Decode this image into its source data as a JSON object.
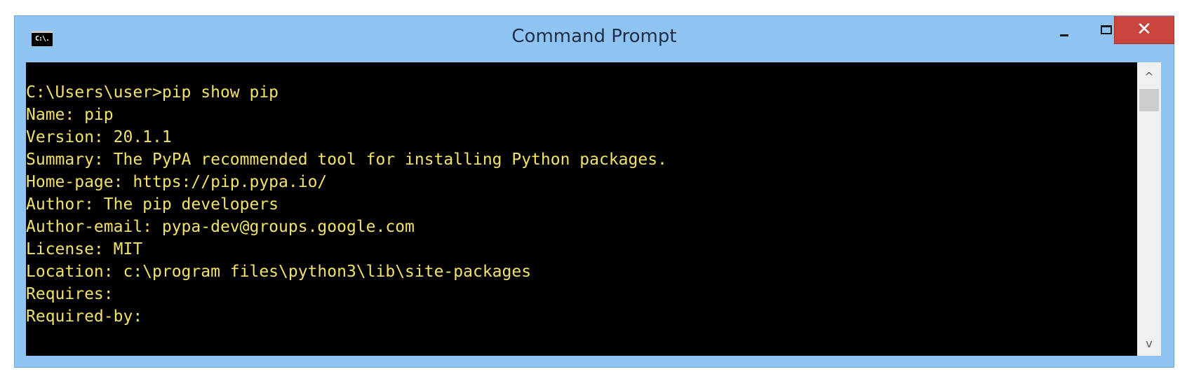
{
  "window": {
    "title": "Command Prompt",
    "icon_label": "C:\\.",
    "icons": {
      "app": "console-icon",
      "minimize": "minimize-icon",
      "maximize": "maximize-icon",
      "close": "close-icon"
    }
  },
  "console": {
    "text_color": "#f2e16b",
    "background": "#000000",
    "lines": [
      "C:\\Users\\user>pip show pip",
      "Name: pip",
      "Version: 20.1.1",
      "Summary: The PyPA recommended tool for installing Python packages.",
      "Home-page: https://pip.pypa.io/",
      "Author: The pip developers",
      "Author-email: pypa-dev@groups.google.com",
      "License: MIT",
      "Location: c:\\program files\\python3\\lib\\site-packages",
      "Requires:",
      "Required-by:"
    ]
  },
  "scrollbar": {
    "up_glyph": "^",
    "down_glyph": "v"
  }
}
